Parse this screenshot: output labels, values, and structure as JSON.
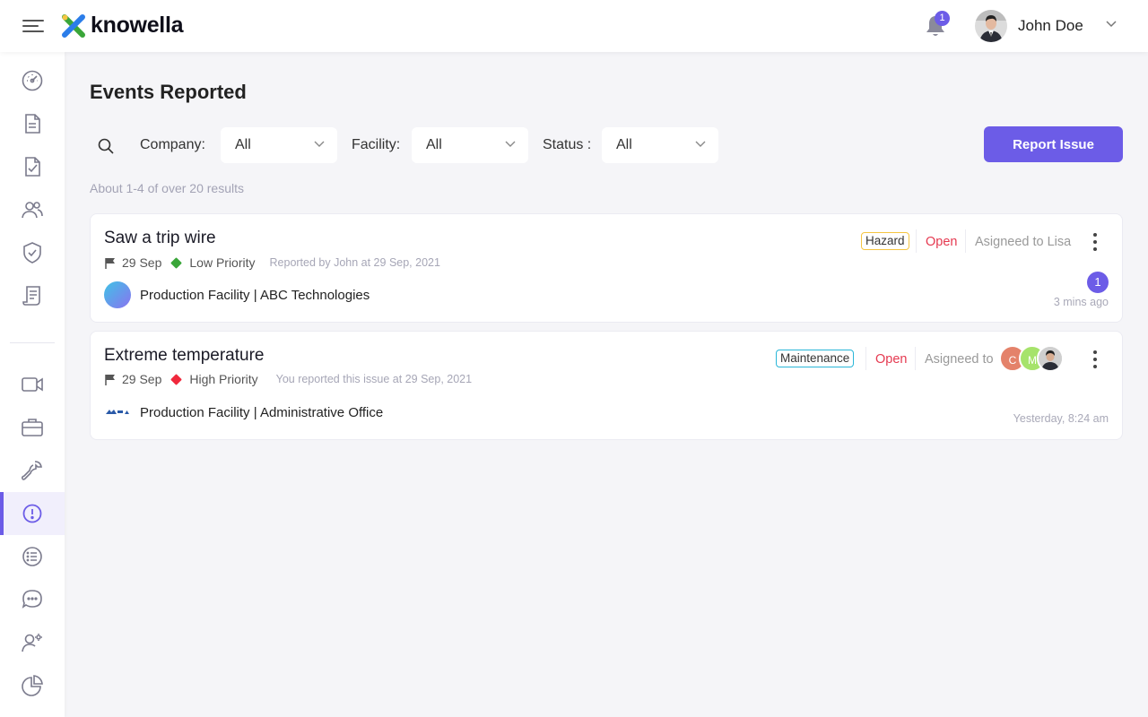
{
  "app": {
    "brand": "knowella",
    "notifications_count": "1",
    "user_name": "John Doe"
  },
  "sidebar": {
    "items": [
      {
        "icon": "dashboard-icon"
      },
      {
        "icon": "document-icon"
      },
      {
        "icon": "checklist-icon"
      },
      {
        "icon": "users-icon"
      },
      {
        "icon": "shield-check-icon"
      },
      {
        "icon": "report-icon"
      },
      {
        "icon": "video-icon"
      },
      {
        "icon": "briefcase-icon"
      },
      {
        "icon": "wrench-icon"
      },
      {
        "icon": "alert-icon",
        "active": true
      },
      {
        "icon": "list-icon"
      },
      {
        "icon": "chat-icon"
      },
      {
        "icon": "user-settings-icon"
      },
      {
        "icon": "pie-chart-icon"
      }
    ]
  },
  "page": {
    "title": "Events Reported",
    "results_text": "About 1-4 of over 20 results",
    "report_button": "Report Issue"
  },
  "filters": {
    "company_label": "Company:",
    "company_value": "All",
    "facility_label": "Facility:",
    "facility_value": "All",
    "status_label": "Status :",
    "status_value": "All"
  },
  "events": [
    {
      "title": "Saw a trip wire",
      "date": "29 Sep",
      "priority": "Low Priority",
      "priority_color": "#3aa639",
      "reported": "Reported by John at 29 Sep, 2021",
      "facility": "Production Facility | ABC Technologies",
      "tag": "Hazard",
      "tag_color": "#f5c542",
      "status": "Open",
      "assigned": "Asigneed to Lisa",
      "comments": "1",
      "time_ago": "3 mins ago"
    },
    {
      "title": "Extreme temperature",
      "date": "29 Sep",
      "priority": "High Priority",
      "priority_color": "#f0283c",
      "reported": "You reported this issue at 29 Sep, 2021",
      "facility": "Production Facility | Administrative Office",
      "tag": "Maintenance",
      "tag_color": "#29b6d8",
      "status": "Open",
      "assigned": "Asigneed to",
      "assignees": [
        "C",
        "M"
      ],
      "time_ago": "Yesterday, 8:24 am"
    }
  ],
  "colors": {
    "accent": "#6c5ce7",
    "open": "#e53950"
  }
}
